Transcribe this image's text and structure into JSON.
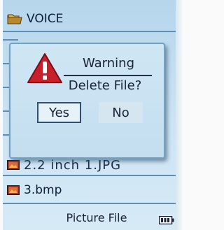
{
  "file_list": {
    "items": [
      {
        "label": "VOICE",
        "icon": "folder-icon"
      },
      {
        "label": "2.2 inch 1.JPG",
        "icon": "image-file-icon"
      },
      {
        "label": "3.bmp",
        "icon": "image-file-icon"
      }
    ]
  },
  "dialog": {
    "title": "Warning",
    "message": "Delete File?",
    "icon": "warning-icon",
    "buttons": {
      "yes": "Yes",
      "no": "No"
    },
    "selected": "yes"
  },
  "status_bar": {
    "title": "Picture File",
    "battery_icon": "battery-icon"
  },
  "colors": {
    "screen_background": "#c2ddf0",
    "row_separator": "#5f8fb5",
    "warning_red": "#c8202a",
    "text": "#1a2236"
  }
}
